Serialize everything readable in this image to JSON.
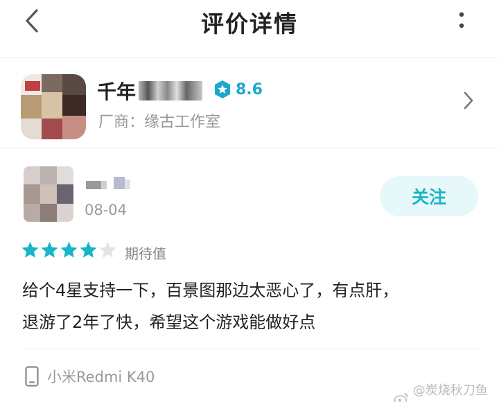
{
  "header": {
    "title": "评价详情",
    "back_icon": "chevron-left-icon",
    "more_icon": "more-vertical-icon"
  },
  "game": {
    "name_visible": "千年",
    "score": "8.6",
    "vendor": "厂商：缘古工作室",
    "score_color": "#1ba8c9"
  },
  "review": {
    "date": "08-04",
    "follow_label": "关注",
    "stars_filled": 4,
    "stars_total": 5,
    "rating_label": "期待值",
    "text_line1": "给个4星支持一下，百景图那边太恶心了，有点肝，",
    "text_line2": "退游了2年了快，希望这个游戏能做好点",
    "accent_color": "#15b6c8"
  },
  "device": {
    "label": "小米Redmi K40",
    "icon": "phone-icon"
  },
  "watermark": {
    "text": "@炭烧秋刀鱼骨"
  }
}
